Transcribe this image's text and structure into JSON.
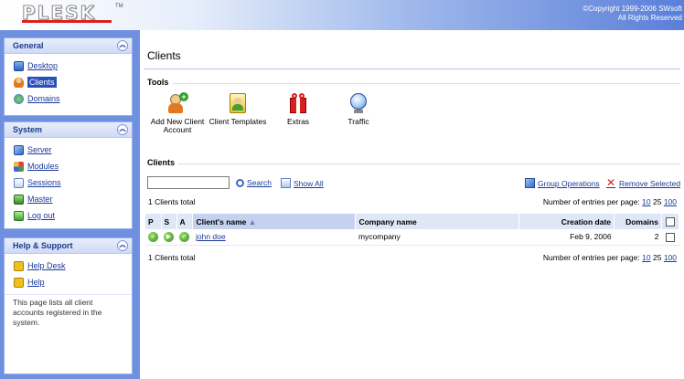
{
  "header": {
    "logo": "PLESK",
    "tm": "TM",
    "copyright_line1": "©Copyright 1999-2006 SWsoft",
    "copyright_line2": "All Rights Reserved"
  },
  "sidebar": {
    "general": {
      "title": "General",
      "items": [
        {
          "label": "Desktop",
          "icon": "desktop-icon"
        },
        {
          "label": "Clients",
          "icon": "clients-icon",
          "active": true
        },
        {
          "label": "Domains",
          "icon": "domains-icon"
        }
      ]
    },
    "system": {
      "title": "System",
      "items": [
        {
          "label": "Server",
          "icon": "server-icon"
        },
        {
          "label": "Modules",
          "icon": "modules-icon"
        },
        {
          "label": "Sessions",
          "icon": "sessions-icon"
        },
        {
          "label": "Master",
          "icon": "master-icon"
        },
        {
          "label": "Log out",
          "icon": "logout-icon"
        }
      ]
    },
    "help": {
      "title": "Help & Support",
      "items": [
        {
          "label": "Help Desk",
          "icon": "helpdesk-icon"
        },
        {
          "label": "Help",
          "icon": "help-icon"
        }
      ],
      "description": "This page lists all client accounts registered in the system."
    }
  },
  "main": {
    "title": "Clients",
    "tools_label": "Tools",
    "tools": [
      {
        "label": "Add New Client Account",
        "icon": "add-client-icon"
      },
      {
        "label": "Client Templates",
        "icon": "client-templates-icon"
      },
      {
        "label": "Extras",
        "icon": "extras-icon"
      },
      {
        "label": "Traffic",
        "icon": "traffic-icon"
      }
    ],
    "clients_label": "Clients",
    "search": {
      "value": "",
      "button": "Search",
      "show_all": "Show All"
    },
    "group_operations": "Group Operations",
    "remove_selected": "Remove Selected",
    "total_text": "1 Clients total",
    "entries_label": "Number of entries per page:",
    "entries_options": [
      "10",
      "25",
      "100"
    ],
    "table": {
      "headers": {
        "p": "P",
        "s": "S",
        "a": "A",
        "name": "Client's name",
        "company": "Company name",
        "created": "Creation date",
        "domains": "Domains"
      },
      "rows": [
        {
          "name": "john doe",
          "company": "mycompany",
          "created": "Feb 9, 2006",
          "domains": "2"
        }
      ]
    }
  },
  "colors": {
    "sidebar_bg": "#6f8fe0",
    "link": "#1a3a9a",
    "header_gradient_end": "#5a7fd8"
  }
}
